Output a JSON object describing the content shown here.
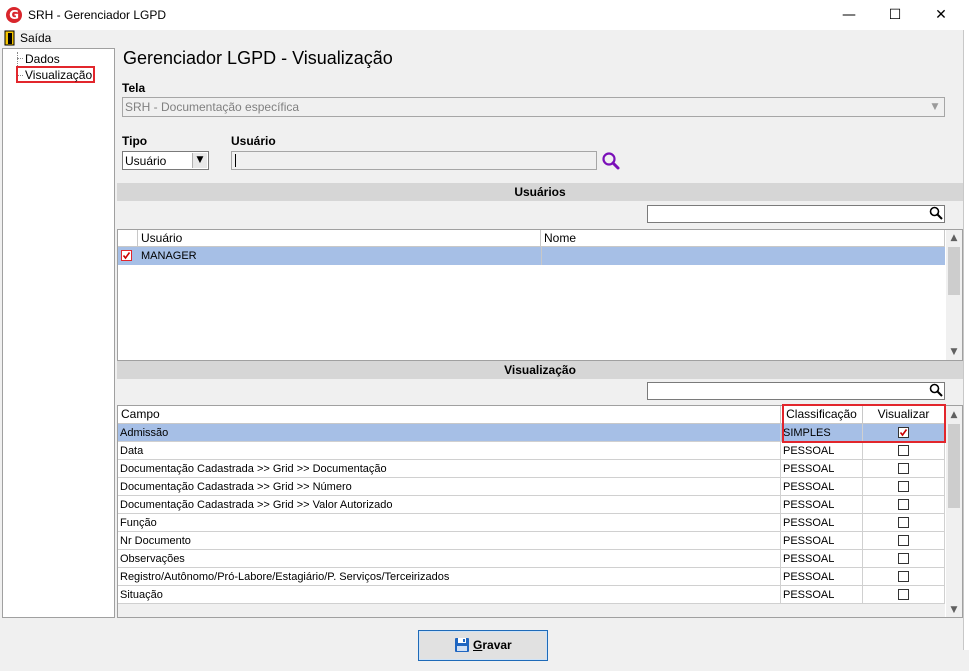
{
  "window": {
    "title": "SRH - Gerenciador LGPD",
    "icon_letter": "G",
    "minimize": "—",
    "maximize": "☐",
    "close": "✕"
  },
  "menu": {
    "exit_label": "Saída"
  },
  "tree": {
    "items": [
      "Dados",
      "Visualização"
    ],
    "selected": "Visualização"
  },
  "page_title": "Gerenciador LGPD - Visualização",
  "tela": {
    "label": "Tela",
    "value": "SRH - Documentação específica"
  },
  "tipo": {
    "label": "Tipo",
    "value": "Usuário"
  },
  "usuario": {
    "label": "Usuário",
    "value": ""
  },
  "usuarios_section": {
    "title": "Usuários",
    "columns": [
      "Usuário",
      "Nome"
    ],
    "rows": [
      {
        "checked": true,
        "usuario": "MANAGER",
        "nome": ""
      }
    ]
  },
  "visualizacao_section": {
    "title": "Visualização",
    "columns": [
      "Campo",
      "Classificação",
      "Visualizar"
    ],
    "rows": [
      {
        "campo": "Admissão",
        "classificacao": "SIMPLES",
        "visualizar": true
      },
      {
        "campo": "Data",
        "classificacao": "PESSOAL",
        "visualizar": false
      },
      {
        "campo": "Documentação Cadastrada >> Grid >> Documentação",
        "classificacao": "PESSOAL",
        "visualizar": false
      },
      {
        "campo": "Documentação Cadastrada >> Grid >> Número",
        "classificacao": "PESSOAL",
        "visualizar": false
      },
      {
        "campo": "Documentação Cadastrada >> Grid >> Valor Autorizado",
        "classificacao": "PESSOAL",
        "visualizar": false
      },
      {
        "campo": "Função",
        "classificacao": "PESSOAL",
        "visualizar": false
      },
      {
        "campo": "Nr Documento",
        "classificacao": "PESSOAL",
        "visualizar": false
      },
      {
        "campo": "Observações",
        "classificacao": "PESSOAL",
        "visualizar": false
      },
      {
        "campo": "Registro/Autônomo/Pró-Labore/Estagiário/P. Serviços/Terceirizados",
        "classificacao": "PESSOAL",
        "visualizar": false
      },
      {
        "campo": "Situação",
        "classificacao": "PESSOAL",
        "visualizar": false
      }
    ]
  },
  "gravar": {
    "label_first": "G",
    "label_rest": "ravar"
  },
  "colors": {
    "selection": "#a6bfe6",
    "highlight_border": "#e2262c",
    "search_icon": "#7a0fb8",
    "app_icon": "#d9262c"
  }
}
